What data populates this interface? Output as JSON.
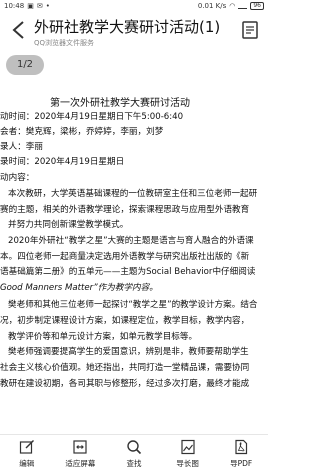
{
  "status_bar": {
    "time": "10:48",
    "speed": "0.01 K/s",
    "battery": "96"
  },
  "header": {
    "title": "外研社教学大赛研讨活动(1)",
    "subtitle": "QQ浏览器文件服务"
  },
  "page_indicator": "1/2",
  "document": {
    "title": "第一次外研社教学大赛研讨活动",
    "lines": [
      "动时间：2020年4月19日星期日下午5:00-6:40",
      "会者：樊克辉，梁彬，乔婷婷，李丽，刘梦",
      "录人：李丽",
      "录时间：2020年4月19日星期日",
      "动内容：",
      "本次教研，大学英语基础课程的一位教研室主任和三位老师一起研",
      "赛的主题，相关的外语教学理论，探索课程思政与应用型外语教育",
      "并努力共同创新课堂教学模式。",
      "2020年外研社“教学之星”大赛的主题是语言与育人融合的外语课",
      "本。四位老师一起商量决定选用外语教学与研究出版社出版的《新",
      "语基础篇第二册》的五单元——主题为Social Behavior中仔细阅读",
      "Good Manners Matter”作为教学内容。",
      "樊老师和其他三位老师一起探讨“教学之星”的教学设计方案。结合",
      "况，初步制定课程设计方案，如课程定位，教学目标，教学内容，",
      "教学评价等和单元设计方案，如单元教学目标等。",
      "樊老师强调要提高学生的爱国意识，辨别是非，教师要帮助学生",
      "社会主义核心价值观。她还指出，共同打造一堂精品课，需要协同",
      "教研在建设初期，各司其职与修整形，经过多次打磨，最终才能成"
    ]
  },
  "toolbar": {
    "edit": "编辑",
    "fit_screen": "适应屏幕",
    "search": "查找",
    "export_image": "导长图",
    "export_pdf": "导PDF"
  }
}
